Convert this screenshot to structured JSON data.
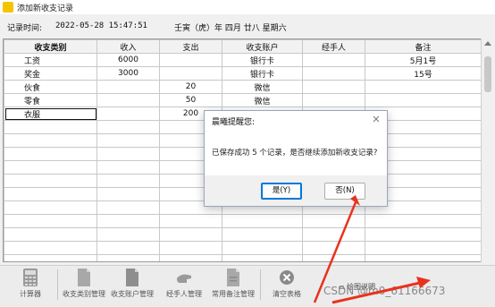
{
  "window": {
    "title": "添加新收支记录"
  },
  "info": {
    "record_time_label": "记录时间:",
    "record_time_value": "2022-05-28 15:47:51",
    "lunar_date": "壬寅（虎）年 四月 廿八 星期六"
  },
  "grid": {
    "headers": [
      "收支类别",
      "收入",
      "支出",
      "收支账户",
      "经手人",
      "备注"
    ],
    "rows": [
      [
        "工资",
        "6000",
        "",
        "银行卡",
        "",
        "5月1号"
      ],
      [
        "奖金",
        "3000",
        "",
        "银行卡",
        "",
        "15号"
      ],
      [
        "伙食",
        "",
        "20",
        "微信",
        "",
        ""
      ],
      [
        "零食",
        "",
        "50",
        "微信",
        "",
        ""
      ],
      [
        "衣服",
        "",
        "200",
        "",
        "",
        ""
      ]
    ],
    "empty_rows": 11
  },
  "dialog": {
    "title": "晨曦提醒您:",
    "message": "已保存成功 5 个记录，是否继续添加新收支记录?",
    "yes_label": "是(Y)",
    "no_label": "否(N)"
  },
  "toolbar": {
    "items": [
      {
        "label": "计算器",
        "icon": "calculator-icon"
      },
      {
        "label": "收支类别管理",
        "icon": "document-icon"
      },
      {
        "label": "收支账户管理",
        "icon": "document-icon"
      },
      {
        "label": "经手人管理",
        "icon": "hand-icon"
      },
      {
        "label": "常用备注管理",
        "icon": "document-icon"
      },
      {
        "label": "清空表格",
        "icon": "clear-icon"
      }
    ],
    "drawing_label": "▫ 绘图说明"
  },
  "watermark": "CSDN @m0_61166673",
  "colors": {
    "accent": "#0078d7",
    "arrow": "#e8321e"
  }
}
